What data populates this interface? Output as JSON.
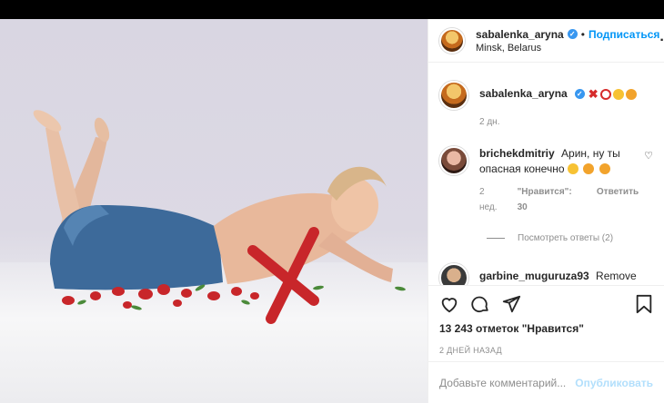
{
  "post": {
    "username": "sabalenka_aryna",
    "follow_label": "Подписаться",
    "location": "Minsk, Belarus",
    "more": "···",
    "caption_time": "2 дн.",
    "likes": "13 243 отметок \"Нравится\"",
    "date": "2 ДНЕЙ НАЗАД"
  },
  "comments": [
    {
      "username": "brichekdmitriy",
      "text": "Арин, ну ты опасная конечно",
      "time": "2 нед.",
      "likes": "\"Нравится\": 30",
      "reply": "Ответить",
      "view_replies": "Посмотреть ответы (2)"
    },
    {
      "username": "garbine_muguruza93",
      "text": "Remove the"
    }
  ],
  "composer": {
    "placeholder": "Добавьте комментарий...",
    "publish": "Опубликовать"
  },
  "icons": {
    "like": "heart-icon",
    "comment": "comment-icon",
    "share": "paper-plane-icon",
    "save": "bookmark-icon"
  },
  "colors": {
    "accent": "#0095f6",
    "verified": "#3897f0",
    "overlay_x": "#c8262a"
  }
}
